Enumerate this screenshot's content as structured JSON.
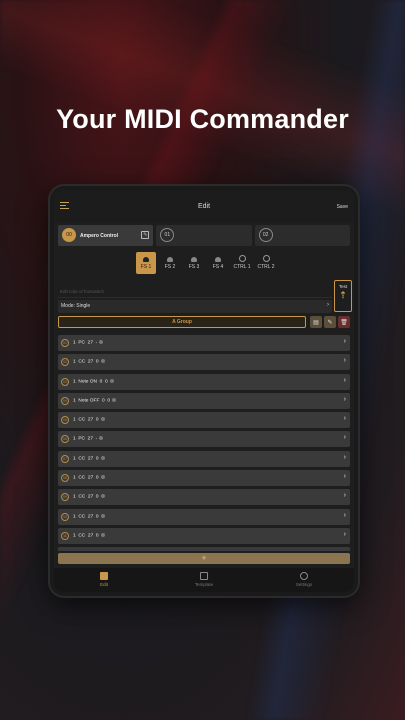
{
  "headline": "Your MIDI Commander",
  "topbar": {
    "title": "Edit",
    "save_label": "Save"
  },
  "presets": [
    {
      "num": "00",
      "name": "Ampero Control",
      "active": true
    },
    {
      "num": "01",
      "name": "",
      "active": false
    },
    {
      "num": "02",
      "name": "",
      "active": false
    }
  ],
  "footswitches": [
    {
      "label": "FS 1",
      "icon": "footswitch-icon",
      "active": true
    },
    {
      "label": "FS 2",
      "icon": "footswitch-icon",
      "active": false
    },
    {
      "label": "FS 3",
      "icon": "footswitch-icon",
      "active": false
    },
    {
      "label": "FS 4",
      "icon": "footswitch-icon",
      "active": false
    },
    {
      "label": "CTRL 1",
      "icon": "knob-icon",
      "active": false
    },
    {
      "label": "CTRL 2",
      "icon": "knob-icon",
      "active": false
    }
  ],
  "note_placeholder": "Edit note of footswitch",
  "mode_label": "Mode: Single",
  "test_label": "Test",
  "group_label": "A Group",
  "messages": [
    {
      "idx": "01",
      "text": "1  PC  27  -"
    },
    {
      "idx": "02",
      "text": "1  CC  27  0"
    },
    {
      "idx": "03",
      "text": "1  Note ON  0  0"
    },
    {
      "idx": "04",
      "text": "1  Note OFF  0  0"
    },
    {
      "idx": "05",
      "text": "1  CC  27  0"
    },
    {
      "idx": "06",
      "text": "1  PC  27  -"
    },
    {
      "idx": "07",
      "text": "1  CC  27  0"
    },
    {
      "idx": "08",
      "text": "1  CC  27  0"
    },
    {
      "idx": "09",
      "text": "1  CC  27  0"
    },
    {
      "idx": "10",
      "text": "1  CC  27  0"
    },
    {
      "idx": "11",
      "text": "1  CC  27  0"
    },
    {
      "idx": "12",
      "text": ""
    }
  ],
  "add_label": "+",
  "tabs": [
    {
      "label": "Edit",
      "icon": "edit-tab-icon",
      "active": true
    },
    {
      "label": "Template",
      "icon": "template-icon",
      "active": false
    },
    {
      "label": "Settings",
      "icon": "gear-icon",
      "active": false
    }
  ],
  "colors": {
    "accent": "#c9964a",
    "danger": "#6a2d2d",
    "row_bg": "#3a3a3a"
  }
}
